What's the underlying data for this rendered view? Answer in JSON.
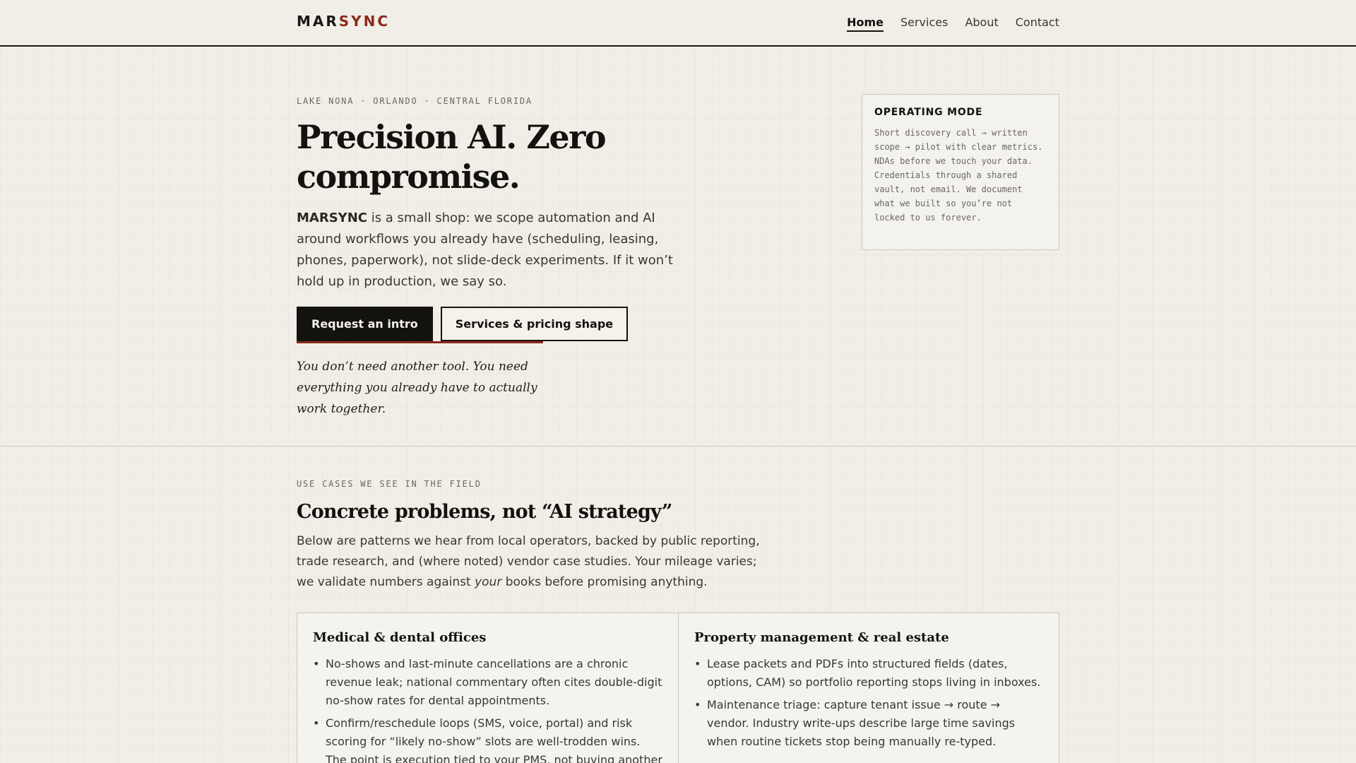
{
  "brand": {
    "part1": "MAR",
    "part2": "SYNC"
  },
  "nav": [
    {
      "label": "Home",
      "active": true
    },
    {
      "label": "Services",
      "active": false
    },
    {
      "label": "About",
      "active": false
    },
    {
      "label": "Contact",
      "active": false
    }
  ],
  "hero": {
    "eyebrow": "LAKE NONA · ORLANDO · CENTRAL FLORIDA",
    "title": "Precision AI. Zero compromise.",
    "lede_strong": "MARSYNC",
    "lede_rest": " is a small shop: we scope automation and AI around workflows you already have (scheduling, leasing, phones, paperwork), not slide-deck experiments. If it won’t hold up in production, we say so.",
    "primary_cta": "Request an intro",
    "secondary_cta": "Services & pricing shape",
    "tagline": "You don’t need another tool. You need everything you already have to actually work together."
  },
  "operating_mode": {
    "title": "OPERATING MODE",
    "body": "Short discovery call → written scope → pilot with clear metrics. NDAs before we touch your data. Credentials through a shared vault, not email. We document what we built so you’re not locked to us forever."
  },
  "use_cases": {
    "eyebrow": "USE CASES WE SEE IN THE FIELD",
    "title": "Concrete problems, not “AI strategy”",
    "intro_before": "Below are patterns we hear from local operators, backed by public reporting, trade research, and (where noted) vendor case studies. Your mileage varies; we validate numbers against ",
    "intro_em": "your",
    "intro_after": " books before promising anything.",
    "cards": [
      {
        "title": "Medical & dental offices",
        "items": [
          "No-shows and last-minute cancellations are a chronic revenue leak; national commentary often cites double-digit no-show rates for dental appointments.",
          "Confirm/reschedule loops (SMS, voice, portal) and risk scoring for “likely no-show” slots are well-trodden wins. The point is execution tied to your PMS, not buying another"
        ]
      },
      {
        "title": "Property management & real estate",
        "items": [
          "Lease packets and PDFs into structured fields (dates, options, CAM) so portfolio reporting stops living in inboxes.",
          "Maintenance triage: capture tenant issue → route → vendor. Industry write-ups describe large time savings when routine tickets stop being manually re-typed."
        ]
      }
    ]
  }
}
